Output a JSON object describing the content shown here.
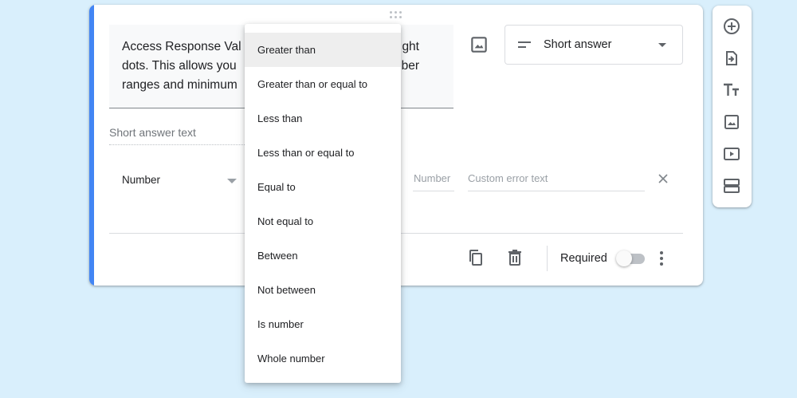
{
  "question": {
    "text": "Access Response Validation by clicking the three vertical, right dots. This allows you to set rules for answers such as number ranges and minimum…",
    "visible_line1": "Access Response Val",
    "visible_line1_tail": "ght",
    "visible_line2": "dots. This allows you",
    "visible_line2_tail": "ber",
    "visible_line3": "ranges and minimum"
  },
  "type_select": {
    "label": "Short answer"
  },
  "short_answer_placeholder": "Short answer text",
  "validation": {
    "type_label": "Number",
    "number_placeholder": "Number",
    "error_placeholder": "Custom error text"
  },
  "footer": {
    "required_label": "Required"
  },
  "dropdown": {
    "selected": "Greater than",
    "options": [
      "Greater than",
      "Greater than or equal to",
      "Less than",
      "Less than or equal to",
      "Equal to",
      "Not equal to",
      "Between",
      "Not between",
      "Is number",
      "Whole number"
    ]
  },
  "colors": {
    "accent": "#4285f4",
    "background": "#d9effc"
  }
}
